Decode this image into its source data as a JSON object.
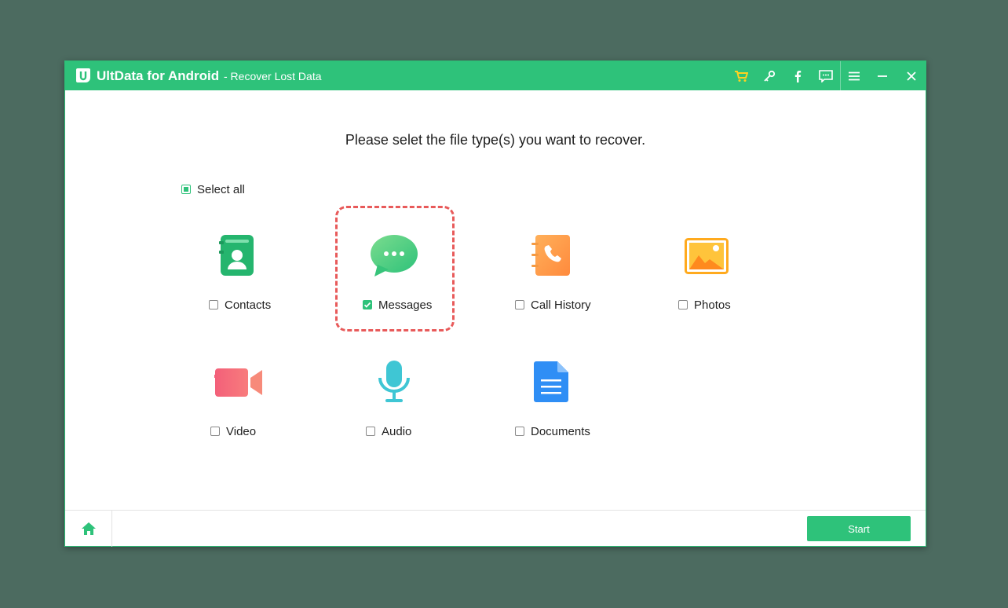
{
  "titlebar": {
    "app_name": "UltData for Android",
    "subtitle": "- Recover Lost Data",
    "buttons": [
      "cart-icon",
      "key-icon",
      "facebook-icon",
      "feedback-icon",
      "menu-icon",
      "minimize-icon",
      "close-icon"
    ]
  },
  "main": {
    "heading": "Please selet the file type(s) you want to recover.",
    "select_all_label": "Select all",
    "select_all_state": "partial",
    "file_types": [
      {
        "label": "Contacts",
        "checked": false,
        "icon": "contacts-icon"
      },
      {
        "label": "Messages",
        "checked": true,
        "icon": "messages-icon"
      },
      {
        "label": "Call History",
        "checked": false,
        "icon": "call-history-icon"
      },
      {
        "label": "Photos",
        "checked": false,
        "icon": "photos-icon"
      },
      {
        "label": "Video",
        "checked": false,
        "icon": "video-icon"
      },
      {
        "label": "Audio",
        "checked": false,
        "icon": "audio-icon"
      },
      {
        "label": "Documents",
        "checked": false,
        "icon": "documents-icon"
      }
    ]
  },
  "footer": {
    "home_icon": "home-icon",
    "start_label": "Start"
  },
  "colors": {
    "accent": "#2ec27a",
    "highlight": "#e85a5a",
    "background": "#4c6b60"
  }
}
